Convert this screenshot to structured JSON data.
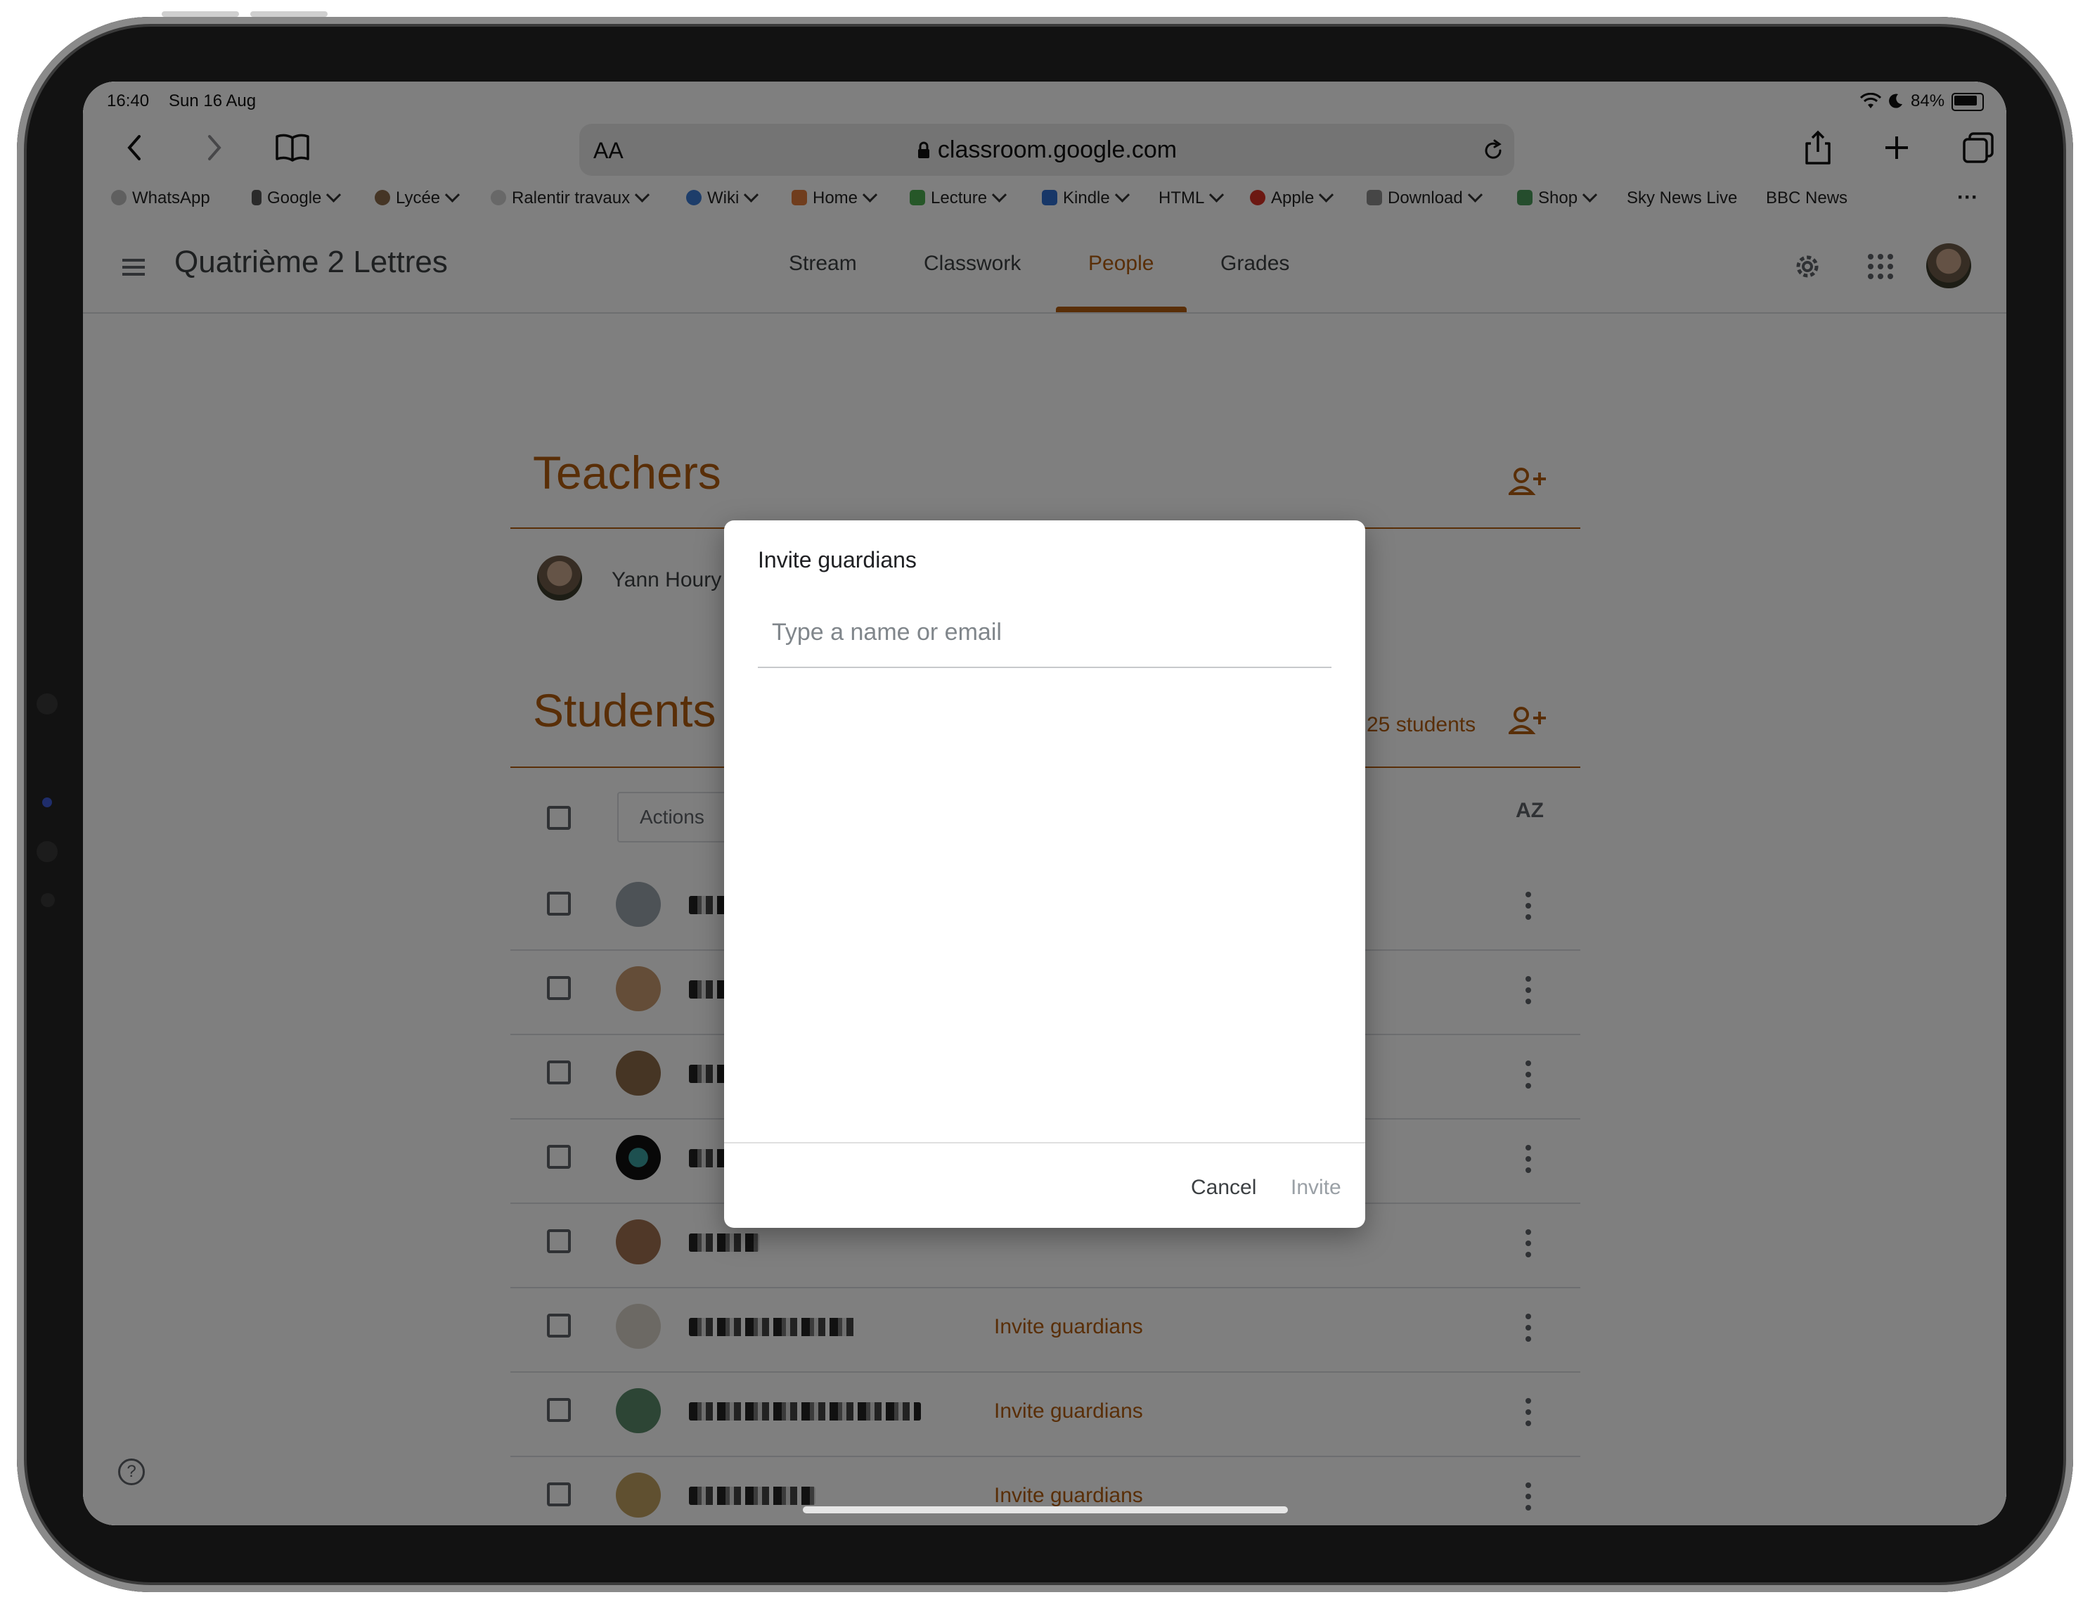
{
  "status_bar": {
    "time": "16:40",
    "date": "Sun 16 Aug",
    "battery": "84%"
  },
  "browser": {
    "text_size_label": "AA",
    "url": "classroom.google.com",
    "bookmarks": [
      {
        "label": "WhatsApp",
        "dropdown": false,
        "color": "#bfbfbf"
      },
      {
        "label": "Google",
        "dropdown": true,
        "color": "#555555"
      },
      {
        "label": "Lycée",
        "dropdown": true,
        "color": "#8a6a4a"
      },
      {
        "label": "Ralentir travaux",
        "dropdown": true,
        "color": "#bdbdbd"
      },
      {
        "label": "Wiki",
        "dropdown": true,
        "color": "#3a7bd5"
      },
      {
        "label": "Home",
        "dropdown": true,
        "color": "#e07a3a"
      },
      {
        "label": "Lecture",
        "dropdown": true,
        "color": "#4caf50"
      },
      {
        "label": "Kindle",
        "dropdown": true,
        "color": "#2f6fd0"
      },
      {
        "label": "HTML",
        "dropdown": true,
        "color": ""
      },
      {
        "label": "Apple",
        "dropdown": true,
        "color": "#d93025"
      },
      {
        "label": "Download",
        "dropdown": true,
        "color": "#8d8d8d"
      },
      {
        "label": "Shop",
        "dropdown": true,
        "color": "#4a9a5a"
      },
      {
        "label": "Sky News Live",
        "dropdown": false,
        "color": ""
      },
      {
        "label": "BBC News",
        "dropdown": false,
        "color": ""
      }
    ],
    "more_label": "···"
  },
  "classroom": {
    "course_title": "Quatrième 2 Lettres",
    "tabs": [
      {
        "label": "Stream",
        "active": false
      },
      {
        "label": "Classwork",
        "active": false
      },
      {
        "label": "People",
        "active": true
      },
      {
        "label": "Grades",
        "active": false
      }
    ],
    "teachers_heading": "Teachers",
    "teacher_name": "Yann Houry",
    "students_heading": "Students",
    "students_count": "25 students",
    "actions_label": "Actions",
    "sort_label": "AZ",
    "invite_link": "Invite guardians",
    "accent_color": "#b35c0e"
  },
  "dialog": {
    "title": "Invite guardians",
    "input_placeholder": "Type a name or email",
    "cancel_label": "Cancel",
    "invite_label": "Invite"
  }
}
